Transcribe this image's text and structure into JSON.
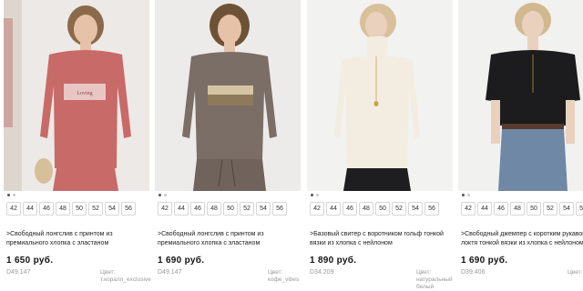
{
  "products": [
    {
      "sizes": [
        "42",
        "44",
        "46",
        "48",
        "50",
        "52",
        "54",
        "56"
      ],
      "title_line1": ">Свободный лонгслив с принтом из",
      "title_line2": "премиального хлопка с эластаном",
      "price": "1 650 руб.",
      "sku": "D49.147",
      "color_label": "Цвет:",
      "color_value": "т.коралл_exclusive",
      "print_text": "Loving",
      "colors": {
        "bg": "#ece9e6",
        "top": "#c86a68",
        "skin": "#e6c2a8",
        "hair": "#8a6a4a"
      }
    },
    {
      "sizes": [
        "42",
        "44",
        "46",
        "48",
        "50",
        "52",
        "54",
        "56"
      ],
      "title_line1": ">Свободный лонгслив с принтом из",
      "title_line2": "премиального хлопка с эластаном",
      "price": "1 690 руб.",
      "sku": "D49.147",
      "color_label": "Цвет:",
      "color_value": "кофе_vibes",
      "colors": {
        "bg": "#ecebe9",
        "top": "#7b6e66",
        "skin": "#e6c2a8",
        "hair": "#6e5236"
      }
    },
    {
      "sizes": [
        "42",
        "44",
        "46",
        "48",
        "50",
        "52",
        "54",
        "56"
      ],
      "title_line1": ">Базовый свитер с воротником гольф тонкой",
      "title_line2": "вязки из хлопка с нейлоном",
      "price": "1 890 руб.",
      "sku": "D34.209",
      "color_label": "Цвет:",
      "color_value": "натуральный",
      "color_value2": "белый",
      "colors": {
        "bg": "#f2f2f0",
        "top": "#f3ede1",
        "skin": "#ead1bd",
        "hair": "#d8c19a"
      }
    },
    {
      "sizes": [
        "42",
        "44",
        "46",
        "48",
        "50",
        "52",
        "54",
        "56"
      ],
      "title_line1": ">Свободный джемпер с коротким рукавом",
      "title_line2": "локтя тонкой вязки из хлопка с нейлоном",
      "price": "1 690 руб.",
      "sku": "D39.406",
      "color_label": "Цвет:",
      "color_value": "",
      "colors": {
        "bg": "#f1f1f0",
        "top": "#1c1c1e",
        "skin": "#ead1bd",
        "hair": "#d2b88e"
      }
    }
  ]
}
